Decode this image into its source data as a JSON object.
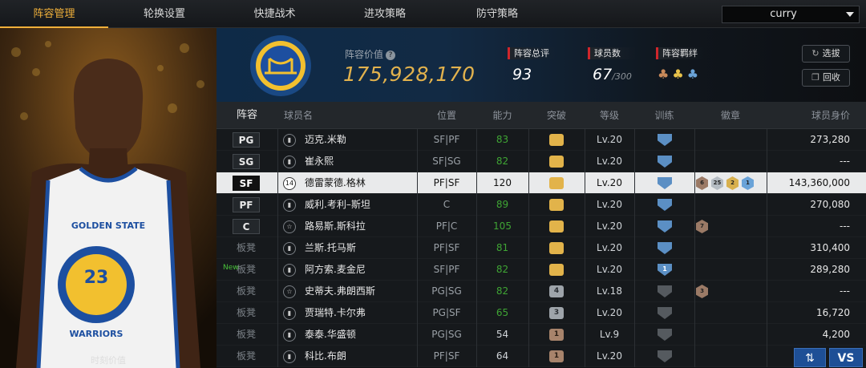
{
  "tabs": [
    "阵容管理",
    "轮换设置",
    "快捷战术",
    "进攻策略",
    "防守策略"
  ],
  "dropdown": {
    "value": "curry"
  },
  "photo": {
    "caption": "时刻价值",
    "jersey_team": "GOLDEN STATE",
    "jersey_number": "23",
    "jersey_name": "WARRIORS"
  },
  "header": {
    "value_label": "阵容价值",
    "value": "175,928,170",
    "stats": [
      {
        "label": "阵容总评",
        "value": "93",
        "suffix": ""
      },
      {
        "label": "球员数",
        "value": "67",
        "suffix": "/300"
      },
      {
        "label": "阵容羁绊",
        "value": "",
        "suffix": ""
      }
    ],
    "buttons": [
      "选拔",
      "回收"
    ]
  },
  "columns": [
    "阵容",
    "球员名",
    "位置",
    "能力",
    "突破",
    "等级",
    "训练",
    "徽章",
    "球员身价"
  ],
  "rows": [
    {
      "slot": "PG",
      "name": "迈克.米勒",
      "pos": "SF|PF",
      "ability": "83",
      "ability_green": true,
      "break": "",
      "break_type": "gold",
      "level": "Lv.20",
      "train": "",
      "train_type": "blue",
      "badges": [],
      "value": "273,280",
      "selected": false,
      "new": false
    },
    {
      "slot": "SG",
      "name": "崔永熙",
      "pos": "SF|SG",
      "ability": "82",
      "ability_green": true,
      "break": "",
      "break_type": "gold",
      "level": "Lv.20",
      "train": "",
      "train_type": "blue",
      "badges": [],
      "value": "---",
      "selected": false,
      "new": false
    },
    {
      "slot": "SF",
      "name": "德雷蒙德.格林",
      "pos": "PF|SF",
      "ability": "120",
      "ability_green": false,
      "break": "",
      "break_type": "gold",
      "level": "Lv.20",
      "train": "",
      "train_type": "blue",
      "badges": [
        {
          "n": "6",
          "t": "bronze"
        },
        {
          "n": "25",
          "t": "silver"
        },
        {
          "n": "2",
          "t": "gold"
        },
        {
          "n": "1",
          "t": "blue"
        }
      ],
      "value": "143,360,000",
      "selected": true,
      "new": false
    },
    {
      "slot": "PF",
      "name": "威利.考利–斯坦",
      "pos": "C",
      "ability": "89",
      "ability_green": true,
      "break": "",
      "break_type": "gold",
      "level": "Lv.20",
      "train": "",
      "train_type": "blue",
      "badges": [],
      "value": "270,080",
      "selected": false,
      "new": false
    },
    {
      "slot": "C",
      "name": "路易斯.斯科拉",
      "pos": "PF|C",
      "ability": "105",
      "ability_green": true,
      "break": "",
      "break_type": "gold",
      "level": "Lv.20",
      "train": "",
      "train_type": "blue",
      "badges": [
        {
          "n": "7",
          "t": "bronze"
        }
      ],
      "value": "---",
      "selected": false,
      "new": false
    },
    {
      "slot": "板凳",
      "name": "兰斯.托马斯",
      "pos": "PF|SF",
      "ability": "81",
      "ability_green": true,
      "break": "",
      "break_type": "gold",
      "level": "Lv.20",
      "train": "",
      "train_type": "blue",
      "badges": [],
      "value": "310,400",
      "selected": false,
      "new": false
    },
    {
      "slot": "板凳",
      "name": "阿方索.麦金尼",
      "pos": "SF|PF",
      "ability": "82",
      "ability_green": true,
      "break": "",
      "break_type": "gold",
      "level": "Lv.20",
      "train": "1",
      "train_type": "blue",
      "badges": [],
      "value": "289,280",
      "selected": false,
      "new": true
    },
    {
      "slot": "板凳",
      "name": "史蒂夫.弗朗西斯",
      "pos": "PG|SG",
      "ability": "82",
      "ability_green": true,
      "break": "4",
      "break_type": "silver",
      "level": "Lv.18",
      "train": "",
      "train_type": "gray",
      "badges": [
        {
          "n": "3",
          "t": "bronze"
        }
      ],
      "value": "---",
      "selected": false,
      "new": false
    },
    {
      "slot": "板凳",
      "name": "贾瑞特.卡尔弗",
      "pos": "PG|SF",
      "ability": "65",
      "ability_green": true,
      "break": "3",
      "break_type": "silver",
      "level": "Lv.20",
      "train": "",
      "train_type": "gray",
      "badges": [],
      "value": "16,720",
      "selected": false,
      "new": false
    },
    {
      "slot": "板凳",
      "name": "泰泰.华盛顿",
      "pos": "PG|SG",
      "ability": "54",
      "ability_green": false,
      "break": "1",
      "break_type": "bronze",
      "level": "Lv.9",
      "train": "",
      "train_type": "gray",
      "badges": [],
      "value": "4,200",
      "selected": false,
      "new": false
    },
    {
      "slot": "板凳",
      "name": "科比.布朗",
      "pos": "PF|SF",
      "ability": "64",
      "ability_green": false,
      "break": "1",
      "break_type": "bronze",
      "level": "Lv.20",
      "train": "",
      "train_type": "gray",
      "badges": [],
      "value": "",
      "selected": false,
      "new": false
    }
  ],
  "new_label": "New",
  "bottom": {
    "swap": "⇅",
    "vs": "VS"
  },
  "colors": {
    "accent": "#f0b03a",
    "value_gold": "#e2b24d",
    "green": "#3fa534",
    "stat_red": "#d0262b",
    "vs_blue": "#1e4f96"
  }
}
